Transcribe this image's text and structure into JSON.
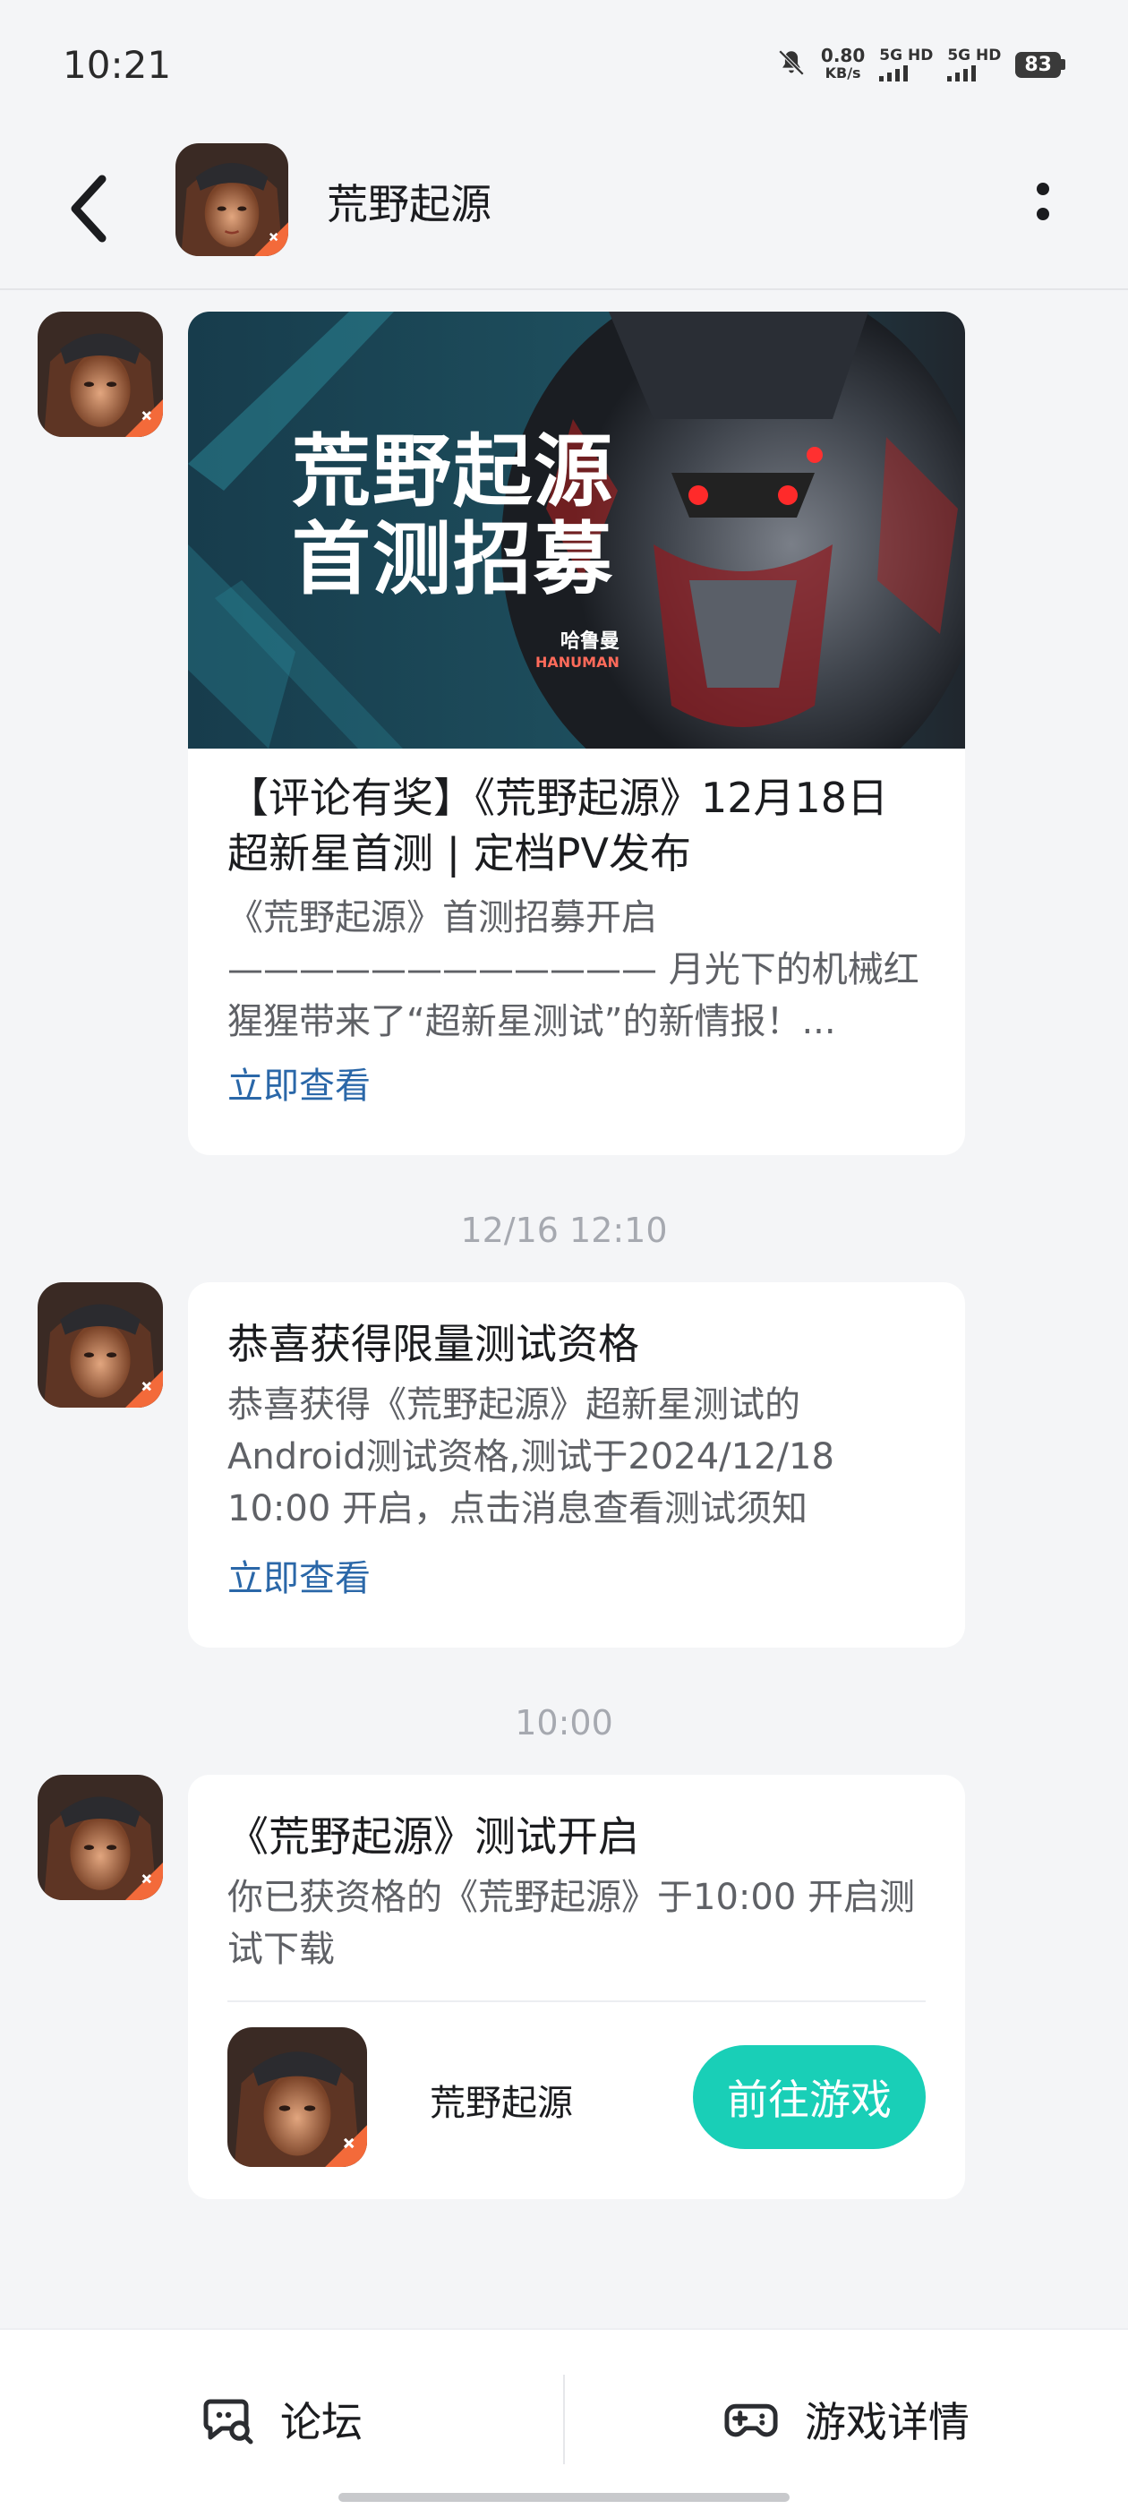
{
  "status_bar": {
    "time": "10:21",
    "net_speed_value": "0.80",
    "net_speed_unit": "KB/s",
    "sim1": "5G HD",
    "sim2": "5G HD",
    "battery": "83",
    "icons": [
      "mute-bell-icon",
      "signal-icon",
      "battery-icon"
    ]
  },
  "header": {
    "title": "荒野起源",
    "icons": [
      "back-arrow-icon",
      "more-vertical-icon"
    ]
  },
  "messages": [
    {
      "banner": {
        "line1": "荒野起源",
        "line2": "首测招募",
        "tag_cn": "哈鲁曼",
        "tag_en": "HANUMAN"
      },
      "title": "【评论有奖】《荒野起源》12月18日超新星首测 | 定档PV发布",
      "body": "《荒野起源》首测招募开启 ———————————— 月光下的机械红猩猩带来了“超新星测试”的新情报！...",
      "link": "立即查看"
    },
    {
      "timestamp": "12/16  12:10",
      "title": "恭喜获得限量测试资格",
      "body": "恭喜获得《荒野起源》超新星测试的Android测试资格,测试于2024/12/18 10:00 开启，点击消息查看测试须知",
      "link": "立即查看"
    },
    {
      "timestamp": "10:00",
      "title": "《荒野起源》测试开启",
      "body": "你已获资格的《荒野起源》于10:00 开启测试下载",
      "game_name": "荒野起源",
      "button": "前往游戏"
    }
  ],
  "bottom_bar": {
    "forum": "论坛",
    "details": "游戏详情",
    "icons": [
      "forum-chat-icon",
      "gamepad-icon"
    ]
  },
  "colors": {
    "accent": "#19cfb7",
    "link": "#2a67a8",
    "background": "#f4f5f7"
  }
}
